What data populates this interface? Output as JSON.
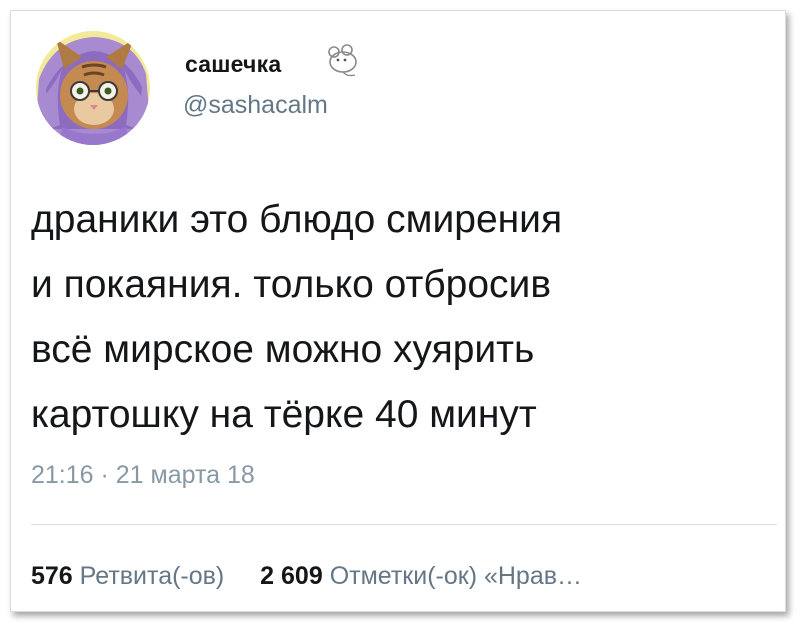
{
  "tweet": {
    "display_name": "сашечка",
    "display_name_emoji": "mouse-icon",
    "handle": "@sashacalm",
    "text": "драники это блюдо смирения\nи покаяния. только отбросив\nвсё мирское можно хуярить\nкартошку на тёрке 40 минут",
    "timestamp": "21:16 · 21 марта 18",
    "stats": {
      "retweets_count": "576",
      "retweets_label": "Ретвита(-ов)",
      "likes_count": "2 609",
      "likes_label": "Отметки(-ок) «Нрав…"
    }
  },
  "colors": {
    "text_primary": "#14171a",
    "text_secondary": "#657786",
    "avatar_bg": "#f2ea98",
    "scarf": "#a88ad0"
  }
}
